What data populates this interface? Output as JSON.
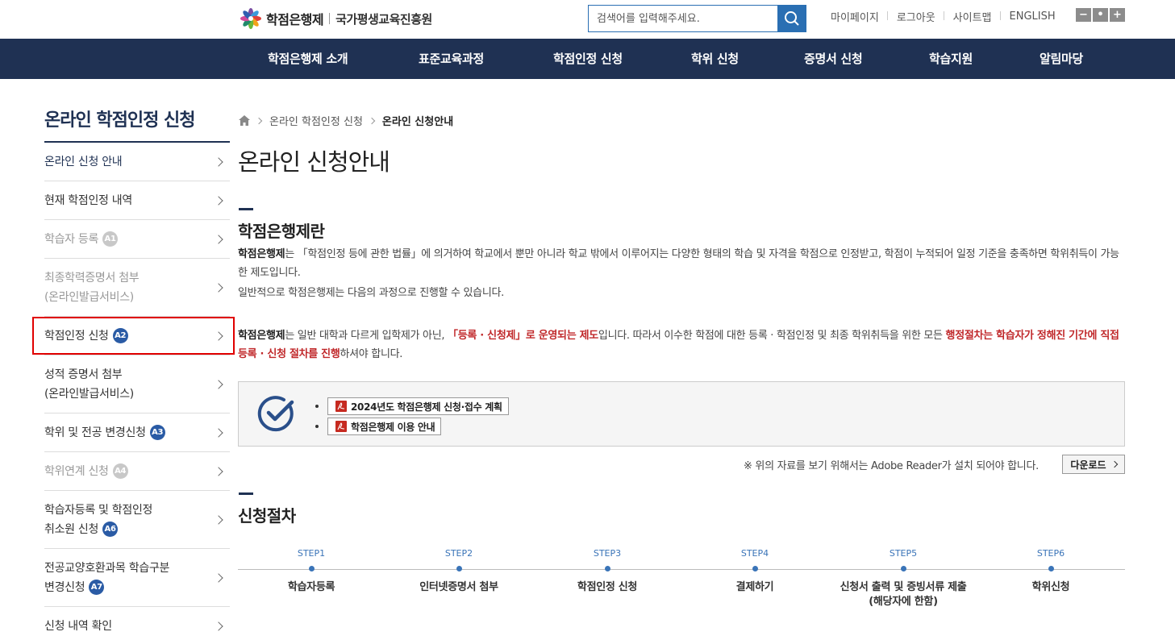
{
  "header": {
    "logo_text": "학점은행제",
    "logo_sub": "국가평생교육진흥원",
    "search_placeholder": "검색어를 입력해주세요.",
    "util_links": [
      "마이페이지",
      "로그아웃",
      "사이트맵",
      "ENGLISH"
    ],
    "zoom": [
      "−",
      "•",
      "+"
    ]
  },
  "gnb": [
    "학점은행제 소개",
    "표준교육과정",
    "학점인정 신청",
    "학위 신청",
    "증명서 신청",
    "학습지원",
    "알림마당"
  ],
  "lnb": {
    "title": "온라인 학점인정 신청",
    "items": [
      {
        "line1": "온라인 신청 안내",
        "line2": "",
        "badge": ""
      },
      {
        "line1": "현재 학점인정 내역",
        "line2": "",
        "badge": ""
      },
      {
        "line1": "학습자 등록",
        "line2": "",
        "badge": "A1"
      },
      {
        "line1": "최종학력증명서 첨부",
        "line2": "(온라인발급서비스)",
        "badge": ""
      },
      {
        "line1": "학점인정 신청",
        "line2": "",
        "badge": "A2"
      },
      {
        "line1": "성적 증명서 첨부",
        "line2": "(온라인발급서비스)",
        "badge": ""
      },
      {
        "line1": "학위 및 전공 변경신청",
        "line2": "",
        "badge": "A3"
      },
      {
        "line1": "학위연계 신청",
        "line2": "",
        "badge": "A4"
      },
      {
        "line1": "학습자등록 및 학점인정",
        "line2": "취소원 신청",
        "badge": "A6"
      },
      {
        "line1": "전공교양호환과목 학습구분",
        "line2": "변경신청",
        "badge": "A7"
      },
      {
        "line1": "신청 내역 확인",
        "line2": "",
        "badge": ""
      }
    ]
  },
  "breadcrumb": {
    "parent": "온라인 학점인정 신청",
    "current": "온라인 신청안내"
  },
  "page_title": "온라인 신청안내",
  "section1": {
    "title": "학점은행제란",
    "p1_bold": "학점은행제",
    "p1_rest": "는 「학점인정 등에 관한 법률」에 의거하여 학교에서 뿐만 아니라 학교 밖에서 이루어지는 다양한 형태의 학습 및 자격을 학점으로 인정받고, 학점이 누적되어 일정 기준을 충족하면 학위취득이 가능한 제도입니다.",
    "p2": "일반적으로 학점은행제는 다음의 과정으로 진행할 수 있습니다.",
    "p3_bold": "학점은행제",
    "p3_a": "는 일반 대학과 다르게 입학제가 아닌, ",
    "p3_red1": "「등록 · 신청제」로 운영되는 제도",
    "p3_b": "입니다. 따라서 이수한 학점에 대한 등록 · 학점인정 및 최종 학위취득을 위한 모든 ",
    "p3_red2": "행정절차는 학습자가 정해진 기간에 직접 등록 · 신청 절차를 진행",
    "p3_c": "하셔야 합니다."
  },
  "downloads": [
    "2024년도 학점은행제 신청·접수 계획",
    "학점은행제 이용 안내"
  ],
  "notice": "※ 위의 자료를 보기 위해서는 Adobe Reader가 설치 되어야 합니다.",
  "download_btn": "다운로드",
  "section2": {
    "title": "신청절차"
  },
  "steps": [
    {
      "num": "STEP1",
      "label": "학습자등록",
      "label2": ""
    },
    {
      "num": "STEP2",
      "label": "인터넷증명서 첨부",
      "label2": ""
    },
    {
      "num": "STEP3",
      "label": "학점인정 신청",
      "label2": ""
    },
    {
      "num": "STEP4",
      "label": "결제하기",
      "label2": ""
    },
    {
      "num": "STEP5",
      "label": "신청서 출력 및 증빙서류 제출",
      "label2": "(해당자에 한함)"
    },
    {
      "num": "STEP6",
      "label": "학위신청",
      "label2": ""
    }
  ],
  "colors": {
    "navy": "#1f3153",
    "blue": "#2a6fb3",
    "red": "#c0282a",
    "highlight": "#e00000"
  }
}
